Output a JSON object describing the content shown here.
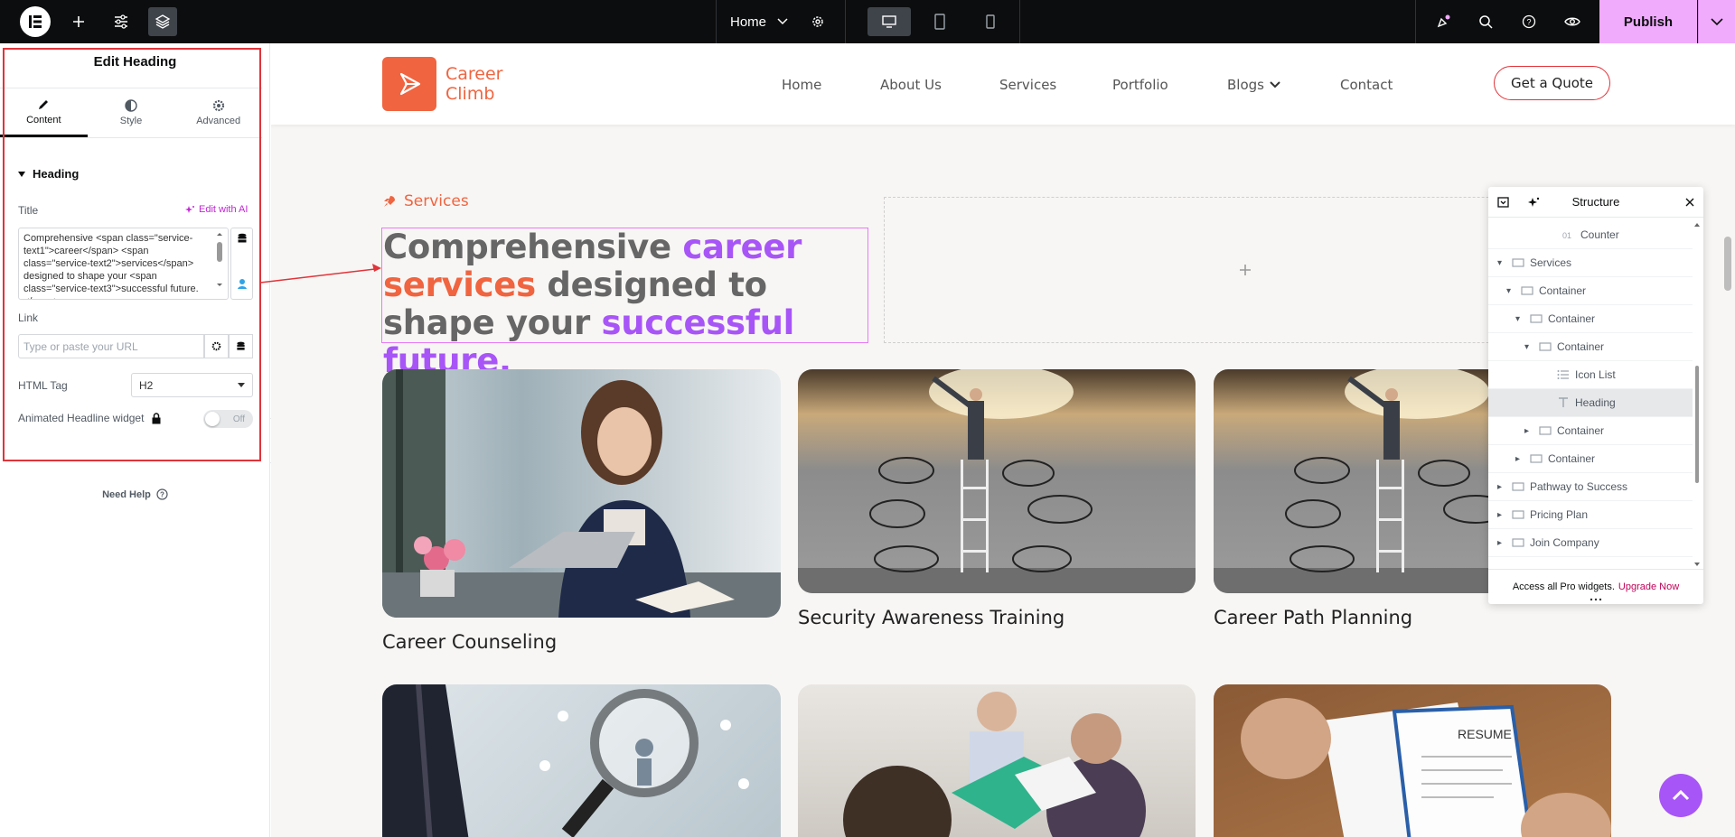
{
  "topbar": {
    "page_name": "Home",
    "publish_label": "Publish"
  },
  "panel": {
    "title": "Edit Heading",
    "tabs": [
      {
        "label": "Content",
        "icon": "pencil-icon",
        "active": true
      },
      {
        "label": "Style",
        "icon": "half-circle-icon",
        "active": false
      },
      {
        "label": "Advanced",
        "icon": "gear-icon",
        "active": false
      }
    ],
    "section_title": "Heading",
    "title_label": "Title",
    "edit_ai_label": "Edit with AI",
    "title_value": "Comprehensive <span class=\"service-text1\">career</span> <span class=\"service-text2\">services</span> designed to shape your <span class=\"service-text3\">successful future.</span>",
    "link_label": "Link",
    "link_placeholder": "Type or paste your URL",
    "html_tag_label": "HTML Tag",
    "html_tag_value": "H2",
    "animated_label": "Animated Headline widget",
    "toggle_label": "Off",
    "need_help": "Need Help"
  },
  "site": {
    "brand_line1": "Career",
    "brand_line2": "Climb",
    "nav": [
      "Home",
      "About Us",
      "Services",
      "Portfolio",
      "Blogs",
      "Contact"
    ],
    "quote_button": "Get a Quote",
    "section_label": "Services",
    "heading": {
      "part1": "Comprehensive ",
      "part2": "career",
      "part3": "services",
      "part4": " designed to shape your ",
      "part5": "successful future."
    },
    "cards": [
      {
        "title": "Career Counseling"
      },
      {
        "title": "Security Awareness Training"
      },
      {
        "title": "Career Path Planning"
      }
    ],
    "colors": {
      "accent_orange": "#f0643f",
      "accent_purple": "#a855f7",
      "editor_pink": "#f0abfc"
    }
  },
  "structure": {
    "title": "Structure",
    "items": [
      {
        "label": "Counter",
        "icon": "counter-icon",
        "arrow": ""
      },
      {
        "label": "Services",
        "icon": "container-icon",
        "arrow": "▾"
      },
      {
        "label": "Container",
        "icon": "container-icon",
        "arrow": "▾"
      },
      {
        "label": "Container",
        "icon": "container-icon",
        "arrow": "▾"
      },
      {
        "label": "Container",
        "icon": "container-icon",
        "arrow": "▾"
      },
      {
        "label": "Icon List",
        "icon": "list-icon",
        "arrow": ""
      },
      {
        "label": "Heading",
        "icon": "heading-icon",
        "arrow": "",
        "selected": true
      },
      {
        "label": "Container",
        "icon": "container-icon",
        "arrow": "▸"
      },
      {
        "label": "Container",
        "icon": "container-icon",
        "arrow": "▸"
      },
      {
        "label": "Pathway to Success",
        "icon": "container-icon",
        "arrow": "▸"
      },
      {
        "label": "Pricing Plan",
        "icon": "container-icon",
        "arrow": "▸"
      },
      {
        "label": "Join Company",
        "icon": "container-icon",
        "arrow": "▸"
      }
    ],
    "footer_text": "Access all Pro widgets.",
    "upgrade_label": "Upgrade Now"
  }
}
